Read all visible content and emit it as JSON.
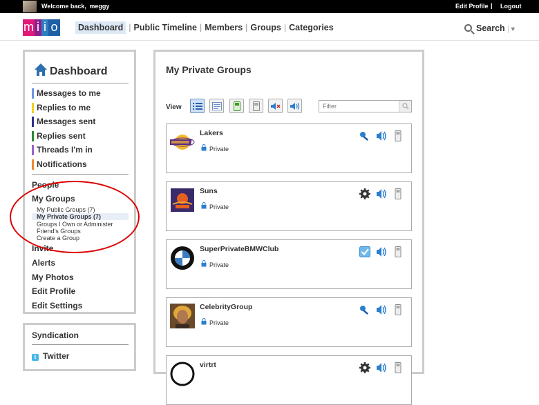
{
  "topbar": {
    "welcome": "Welcome back,",
    "username": "meggy",
    "edit_profile": "Edit Profile",
    "separator": "|",
    "logout": "Logout"
  },
  "nav": {
    "logo_letters": [
      "m",
      "i",
      "l",
      "o"
    ],
    "links": [
      "Dashboard",
      "Public Timeline",
      "Members",
      "Groups",
      "Categories"
    ],
    "separator": "|",
    "search_label": "Search",
    "search_caret": "▾"
  },
  "sidebar": {
    "title": "Dashboard",
    "messages": [
      {
        "label": "Messages to me",
        "color": "#6f95e6"
      },
      {
        "label": "Replies to me",
        "color": "#f1cf1f"
      },
      {
        "label": "Messages sent",
        "color": "#2b2f8f"
      },
      {
        "label": "Replies sent",
        "color": "#2a8a2e"
      },
      {
        "label": "Threads I'm in",
        "color": "#9a62c8"
      },
      {
        "label": "Notifications",
        "color": "#f08a2c"
      }
    ],
    "people": "People",
    "my_groups": "My Groups",
    "group_sub": [
      "My Public Groups (7)",
      "My Private Groups (7)",
      "Groups I Own or Administer",
      "Friend's Groups",
      "Create a Group"
    ],
    "other_links": [
      "Invite",
      "Alerts",
      "My Photos",
      "Edit Profile",
      "Edit Settings"
    ]
  },
  "syndication": {
    "title": "Syndication",
    "twitter": "Twitter"
  },
  "main": {
    "title": "My Private Groups",
    "view_label": "View",
    "filter_placeholder": "Filter",
    "groups": [
      {
        "name": "Lakers",
        "privacy": "Private",
        "logo": "lakers-logo",
        "first_icon": "key-icon"
      },
      {
        "name": "Suns",
        "privacy": "Private",
        "logo": "suns-logo",
        "first_icon": "gear-icon"
      },
      {
        "name": "SuperPrivateBMWClub",
        "privacy": "Private",
        "logo": "bmw-logo",
        "first_icon": "checkbox-icon"
      },
      {
        "name": "CelebrityGroup",
        "privacy": "Private",
        "logo": "celebrity-photo",
        "first_icon": "key-icon"
      },
      {
        "name": "virtrt",
        "privacy": "",
        "logo": "virtrt-logo",
        "first_icon": "gear-icon"
      }
    ]
  }
}
